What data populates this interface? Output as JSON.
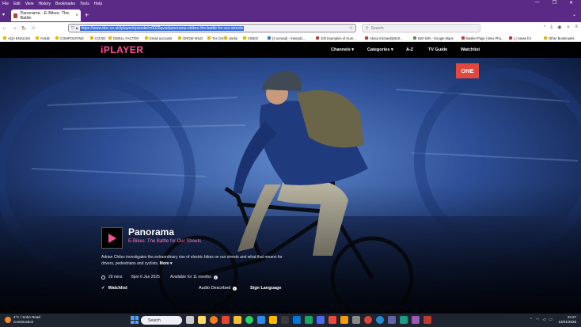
{
  "menu": [
    "File",
    "Edit",
    "View",
    "History",
    "Bookmarks",
    "Tools",
    "Help"
  ],
  "window_controls": [
    "—",
    "❐",
    "✕"
  ],
  "tab": {
    "title": "Panorama - E-Bikes: The Battle",
    "close": "×"
  },
  "new_tab": "+",
  "url": "https://www.bbc.co.uk/iplayer/episode/m0026qvw/panorama-ebikes-the-battle-for-our-streets",
  "search_placeholder": "Search",
  "bookmarks": [
    "AQA ENGLISH",
    "AHUB",
    "COMPOSITING",
    "COVID",
    "DWELL FACTOR",
    "Email accounts",
    "GROW WILD",
    "TAI CHI",
    "useful",
    "VIDEO",
    "(2 unread) - mikeyd1...",
    "100 Examples of Hum...",
    "About michaeltj2918...",
    "B20 8JN - Google Maps",
    "Basket Page | Wex Pho...",
    "L | News for",
    "Other Bookmarks"
  ],
  "iplayer": {
    "logo": "iPLAYER",
    "nav": [
      "Channels ▾",
      "Categories ▾",
      "A-Z",
      "TV Guide",
      "Watchlist"
    ],
    "channel_badge": "ONE",
    "programme": {
      "title": "Panorama",
      "subtitle": "E-Bikes: The Battle for Our Streets",
      "description": "Adrian Chiles investigates the extraordinary rise of electric bikes on our streets and what that means for drivers, pedestrians and cyclists.",
      "more": "More ▾",
      "duration": "29 mins",
      "broadcast": "8pm 6 Jan 2025",
      "availability": "Available for 11 months",
      "actions": [
        "Watchlist",
        "Audio Described",
        "Sign Language"
      ]
    }
  },
  "taskbar": {
    "weather_temp": "4°C / Soho Road",
    "weather_desc": "Construction",
    "search": "Search",
    "time": "22:27",
    "date": "13/01/2025"
  }
}
